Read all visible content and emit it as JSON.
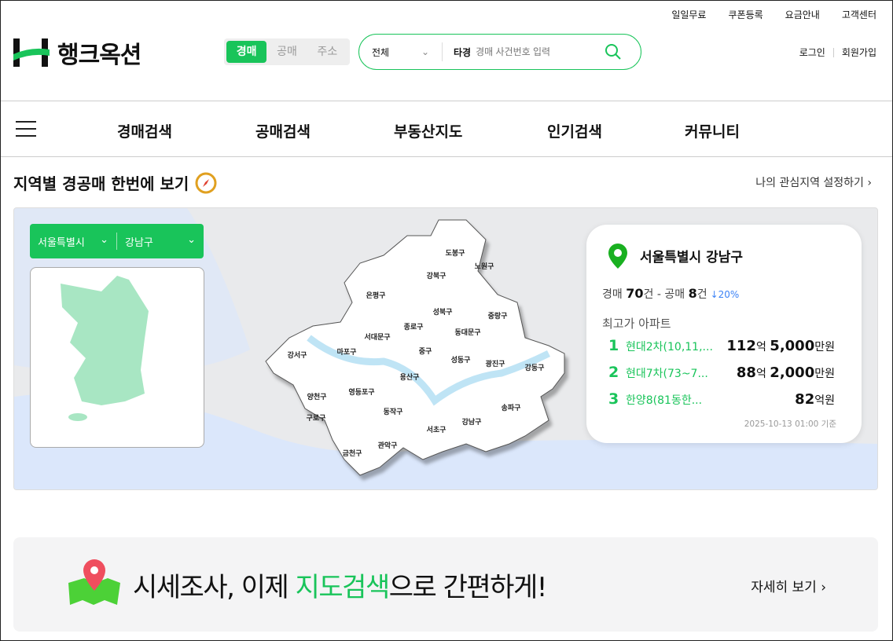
{
  "header": {
    "util_links": [
      "일일무료",
      "쿠폰등록",
      "요금안내",
      "고객센터"
    ],
    "logo": "행크옥션",
    "seg_tabs": [
      "경매",
      "공매",
      "주소"
    ],
    "active_seg": 0,
    "search": {
      "scope": "전체",
      "label": "타경",
      "placeholder": "경매 사건번호 입력"
    },
    "login": "로그인",
    "signup": "회원가입"
  },
  "nav": [
    "경매검색",
    "공매검색",
    "부동산지도",
    "인기검색",
    "커뮤니티"
  ],
  "section": {
    "title": "지역별 경공매 한번에 보기",
    "interest_link": "나의 관심지역 설정하기"
  },
  "region": {
    "city": "서울특별시",
    "district": "강남구"
  },
  "districts": [
    "도봉구",
    "노원구",
    "강북구",
    "은평구",
    "성북구",
    "중랑구",
    "종로구",
    "동대문구",
    "서대문구",
    "강서구",
    "마포구",
    "중구",
    "성동구",
    "광진구",
    "강동구",
    "용산구",
    "양천구",
    "영등포구",
    "동작구",
    "구로구",
    "서초구",
    "강남구",
    "송파구",
    "관악구",
    "금천구"
  ],
  "card": {
    "title": "서울특별시 강남구",
    "auction_label": "경매",
    "auction_count": "70",
    "unit": "건",
    "sep": "-",
    "public_label": "공매",
    "public_count": "8",
    "change": "↓20%",
    "sub": "최고가 아파트",
    "top": [
      {
        "rank": "1",
        "name": "현대2차(10,11,...",
        "eok": "112",
        "man": "5,000"
      },
      {
        "rank": "2",
        "name": "현대7차(73~7...",
        "eok": "88",
        "man": "2,000"
      },
      {
        "rank": "3",
        "name": "한양8(81동한...",
        "eok": "82",
        "man": ""
      }
    ],
    "eok_unit": "억",
    "man_unit": "만원",
    "won_unit": "원",
    "eokwon_unit": "억원",
    "timestamp": "2025-10-13 01:00 기준"
  },
  "banner": {
    "pre": "시세조사, 이제 ",
    "highlight": "지도검색",
    "post": "으로 간편하게!",
    "more": "자세히 보기"
  },
  "colors": {
    "brand": "#19c45a"
  }
}
